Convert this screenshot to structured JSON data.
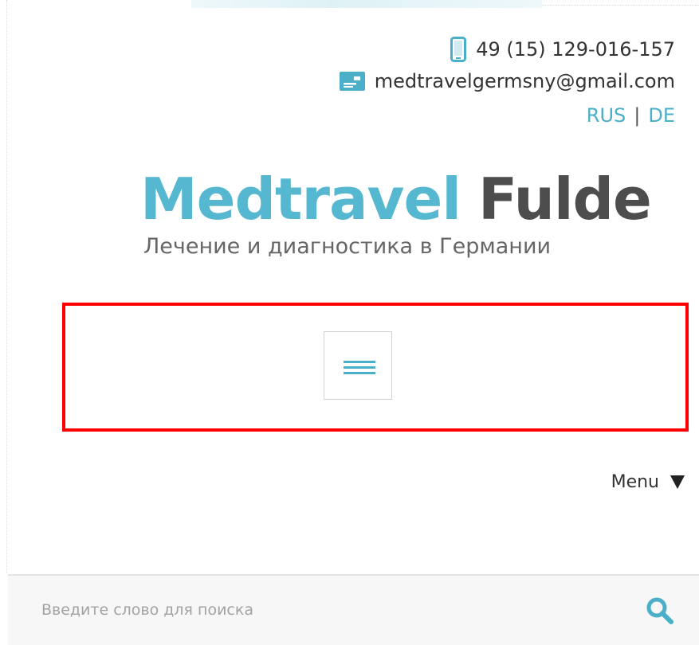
{
  "header": {
    "phone": "49 (15) 129-016-157",
    "email": "medtravelgermsny@gmail.com",
    "languages": [
      {
        "label": "RUS"
      },
      {
        "label": "DE"
      }
    ],
    "lang_separator": "|"
  },
  "logo": {
    "part1": "Medtravel",
    "part2": "Fulde",
    "tagline": "Лечение и диагностика в Германии"
  },
  "nav": {
    "menu_label": "Menu"
  },
  "search": {
    "placeholder": "Введите слово для поиска",
    "value": ""
  },
  "icons": {
    "phone": "phone-icon",
    "mail": "mail-icon",
    "hamburger": "hamburger-icon",
    "menu_arrow": "triangle-down-icon",
    "search": "search-icon"
  },
  "colors": {
    "accent": "#4aafc7",
    "logo_blue": "#55b8d0",
    "logo_dark": "#4d4d4d",
    "highlight_frame": "#ff0000"
  }
}
